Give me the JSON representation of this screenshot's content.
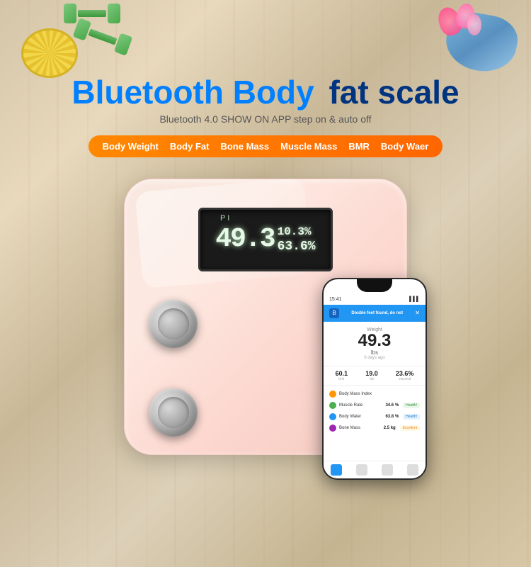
{
  "page": {
    "background_color": "#d4c4a8"
  },
  "header": {
    "title_part1": "Bluetooth Body",
    "title_part2": "fat scale",
    "subtitle": "Bluetooth 4.0  SHOW ON APP  step on  & auto off"
  },
  "features": {
    "items": [
      {
        "label": "Body Weight"
      },
      {
        "label": "Body Fat"
      },
      {
        "label": "Bone Mass"
      },
      {
        "label": "Muscle Mass"
      },
      {
        "label": "BMR"
      },
      {
        "label": "Body Waer"
      }
    ]
  },
  "scale": {
    "lcd": {
      "main_value": "49.3",
      "side_top": "10.3%",
      "side_bottom": "63.6%",
      "label_pi": "P I"
    }
  },
  "phone": {
    "status_time": "15:41",
    "status_signal": "▌▌▌",
    "app_header": "Double feet found, do not",
    "app_title_main": "Weight",
    "weight_value": "49.3",
    "weight_unit": "lbs",
    "date": "6 days ago",
    "stats": [
      {
        "value": "60.1",
        "label": "bmi"
      },
      {
        "value": "19.0",
        "label": "fat"
      },
      {
        "value": "23.6%",
        "label": "visceral"
      }
    ],
    "metrics": [
      {
        "name": "Body Mass Index",
        "value": "",
        "color": "#FF9800",
        "badge": ""
      },
      {
        "name": "Muscle Rate",
        "value": "34.6 %",
        "color": "#4CAF50",
        "badge": "Health!"
      },
      {
        "name": "Body Water",
        "value": "63.8 %",
        "color": "#2196F3",
        "badge": "Health!"
      },
      {
        "name": "Bone Mass",
        "value": "2.5 kg",
        "color": "#9C27B0",
        "badge": "Excellent"
      }
    ]
  }
}
